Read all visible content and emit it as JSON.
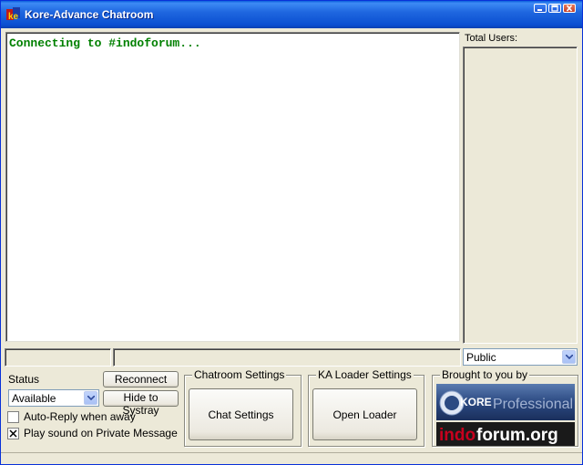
{
  "window": {
    "title": "Kore-Advance Chatroom"
  },
  "chat": {
    "messages": [
      "Connecting to #indoforum..."
    ],
    "message_color": "#008000"
  },
  "users": {
    "label": "Total Users:"
  },
  "input_row": {
    "nick_value": "",
    "message_value": "",
    "channel_selected": "Public"
  },
  "controls": {
    "status_label": "Status",
    "status_selected": "Available",
    "reconnect_label": "Reconnect",
    "systray_label": "Hide to Systray",
    "autoreply_label": "Auto-Reply when away",
    "autoreply_checked": false,
    "sound_label": "Play sound on Private Message",
    "sound_checked": true
  },
  "groups": {
    "chatroom_title": "Chatroom Settings",
    "chat_settings_label": "Chat Settings",
    "loader_title": "KA Loader Settings",
    "open_loader_label": "Open Loader",
    "brought_title": "Brought to you by"
  },
  "branding": {
    "kore_logo_text": "KORE",
    "kore_logo_sub": "Professional",
    "indo_logo_red": "indo",
    "indo_logo_white": "forum.org"
  },
  "icons": {
    "app": "app-icon",
    "minimize": "minimize-icon",
    "maximize": "maximize-icon",
    "close": "close-icon",
    "dropdown": "chevron-down-icon",
    "checkmark": "checkmark-icon"
  },
  "colors": {
    "titlebar": "#0b4fd1",
    "window_bg": "#ece9d8",
    "brand_red": "#c8001e"
  }
}
